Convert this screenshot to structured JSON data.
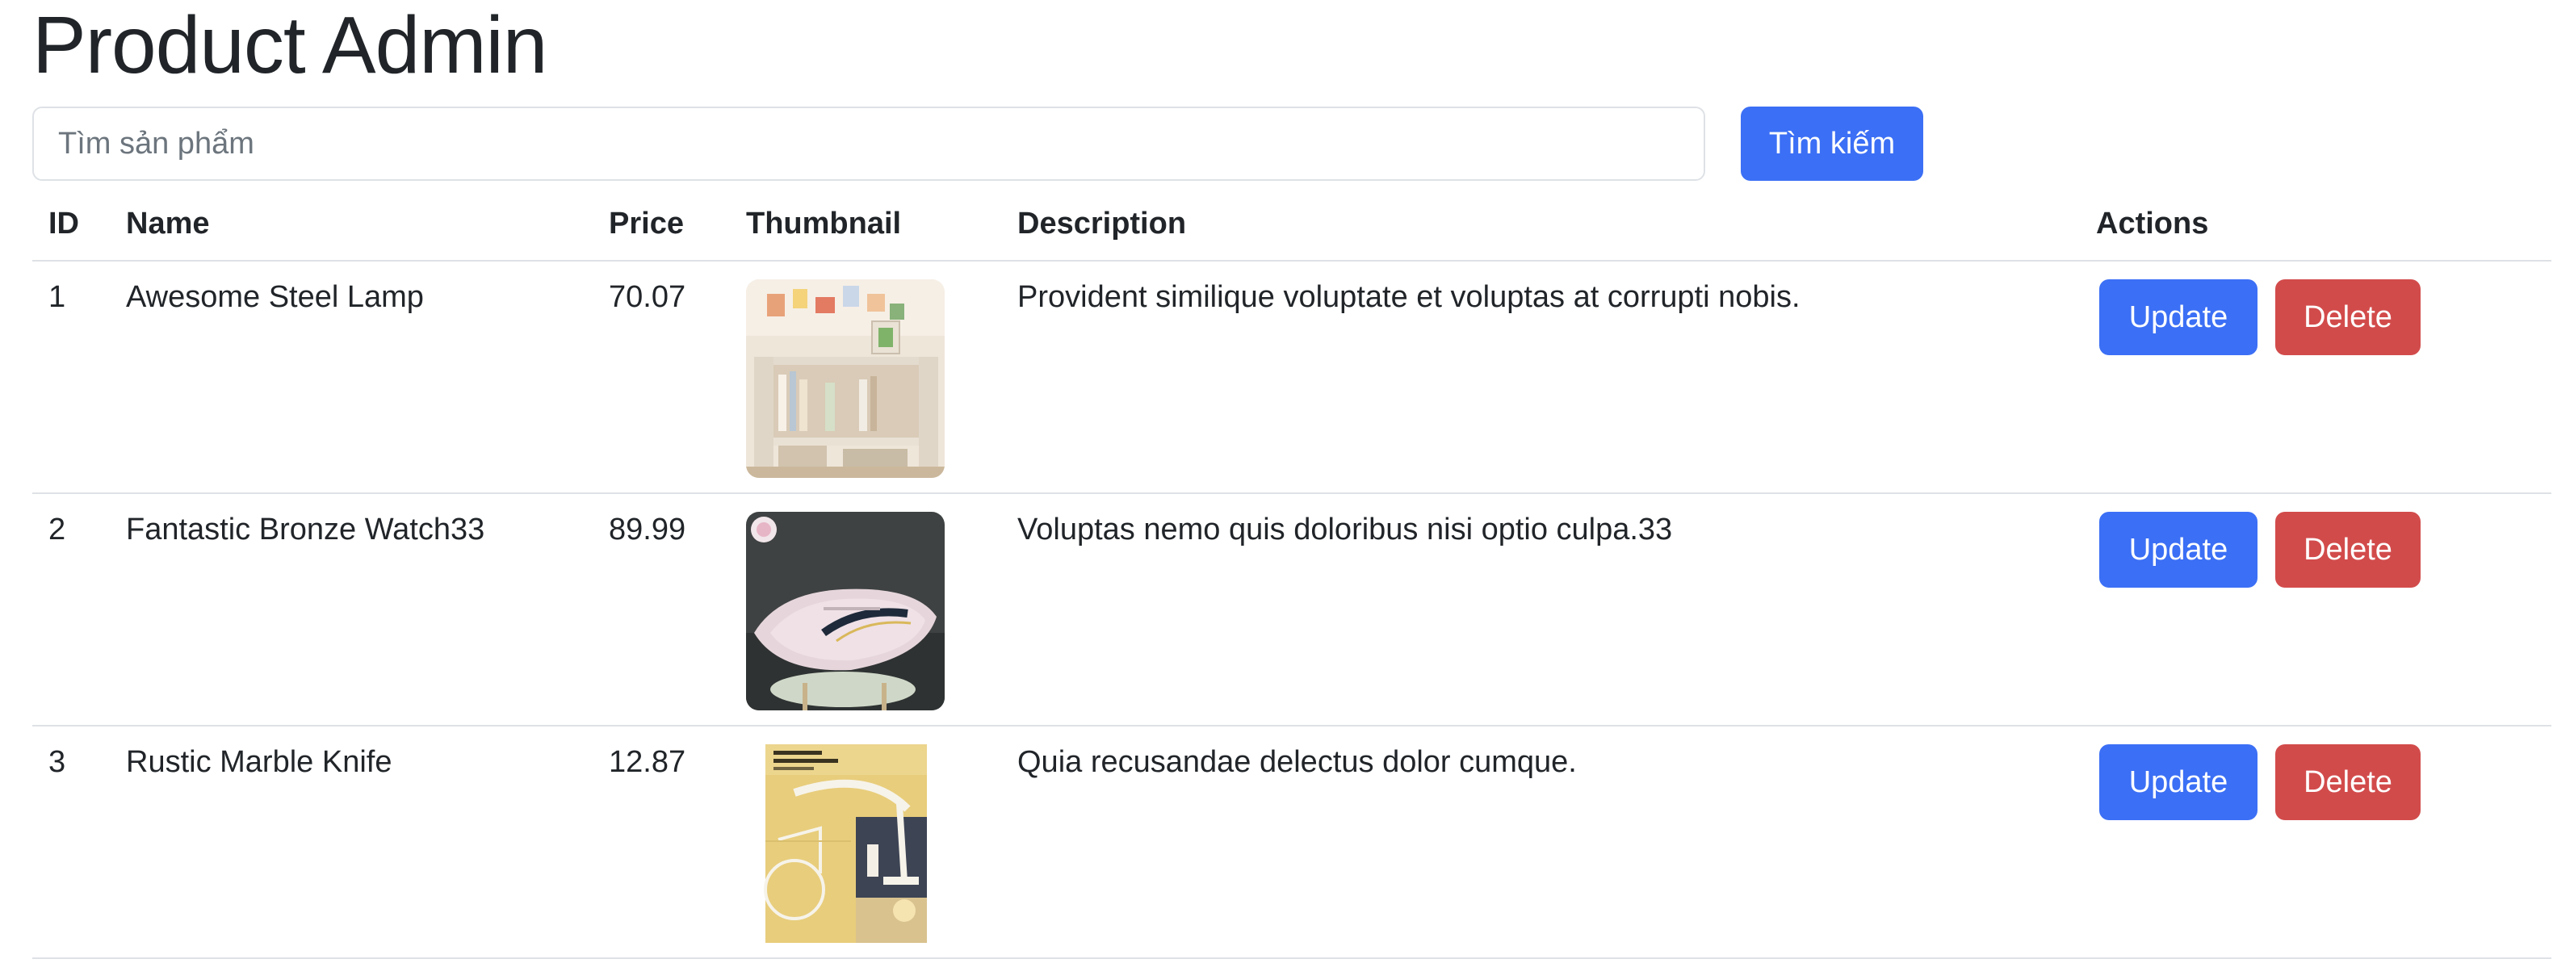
{
  "header": {
    "title": "Product Admin"
  },
  "search": {
    "placeholder": "Tìm sản phẩm",
    "value": "",
    "button_label": "Tìm kiếm"
  },
  "table": {
    "columns": {
      "id": "ID",
      "name": "Name",
      "price": "Price",
      "thumbnail": "Thumbnail",
      "description": "Description",
      "actions": "Actions"
    },
    "rows": [
      {
        "id": "1",
        "name": "Awesome Steel Lamp",
        "price": "70.07",
        "thumbnail_icon": "bookshelf-photo",
        "description": "Provident similique voluptate et voluptas at corrupti nobis.",
        "update_label": "Update",
        "delete_label": "Delete"
      },
      {
        "id": "2",
        "name": "Fantastic Bronze Watch33",
        "price": "89.99",
        "thumbnail_icon": "pillow-photo",
        "description": "Voluptas nemo quis doloribus nisi optio culpa.33",
        "update_label": "Update",
        "delete_label": "Delete"
      },
      {
        "id": "3",
        "name": "Rustic Marble Knife",
        "price": "12.87",
        "thumbnail_icon": "desk-lamp-photo",
        "description": "Quia recusandae delectus dolor cumque.",
        "update_label": "Update",
        "delete_label": "Delete"
      }
    ]
  },
  "colors": {
    "primary": "#3b6ff5",
    "danger": "#d24b4b",
    "text": "#212529",
    "border": "#dee2e6"
  }
}
